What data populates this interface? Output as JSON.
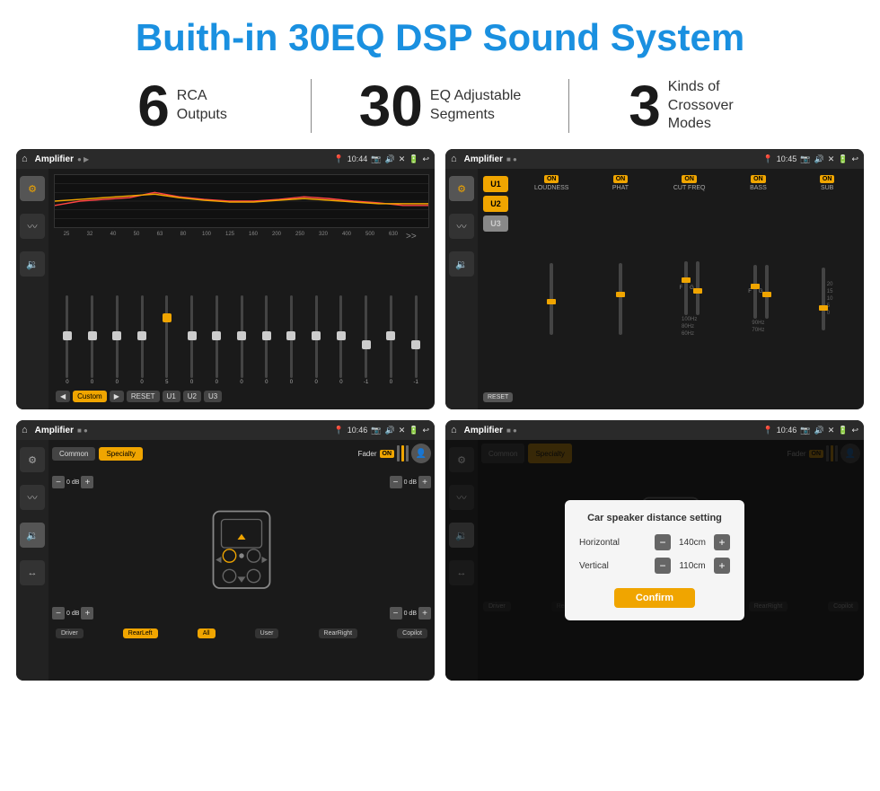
{
  "page": {
    "title": "Buith-in 30EQ DSP Sound System"
  },
  "stats": [
    {
      "number": "6",
      "label": "RCA\nOutputs"
    },
    {
      "number": "30",
      "label": "EQ Adjustable\nSegments"
    },
    {
      "number": "3",
      "label": "Kinds of\nCrossover Modes"
    }
  ],
  "screens": [
    {
      "id": "screen1",
      "statusBar": {
        "appTitle": "Amplifier",
        "time": "10:44"
      }
    },
    {
      "id": "screen2",
      "statusBar": {
        "appTitle": "Amplifier",
        "time": "10:45"
      }
    },
    {
      "id": "screen3",
      "statusBar": {
        "appTitle": "Amplifier",
        "time": "10:46"
      }
    },
    {
      "id": "screen4",
      "statusBar": {
        "appTitle": "Amplifier",
        "time": "10:46"
      },
      "dialog": {
        "title": "Car speaker distance setting",
        "fields": [
          {
            "label": "Horizontal",
            "value": "140cm"
          },
          {
            "label": "Vertical",
            "value": "110cm"
          }
        ],
        "confirmLabel": "Confirm"
      }
    }
  ],
  "eq": {
    "freqLabels": [
      "25",
      "32",
      "40",
      "50",
      "63",
      "80",
      "100",
      "125",
      "160",
      "200",
      "250",
      "320",
      "400",
      "500",
      "630"
    ],
    "values": [
      "0",
      "0",
      "0",
      "0",
      "5",
      "0",
      "0",
      "0",
      "0",
      "0",
      "0",
      "0",
      "-1",
      "0",
      "-1"
    ],
    "presetButtons": [
      "Custom",
      "RESET",
      "U1",
      "U2",
      "U3"
    ]
  },
  "crossover": {
    "channels": [
      "LOUDNESS",
      "PHAT",
      "CUT FREQ",
      "BASS",
      "SUB"
    ],
    "uButtons": [
      "U1",
      "U2",
      "U3"
    ],
    "resetLabel": "RESET"
  },
  "speaker": {
    "tabs": [
      "Common",
      "Specialty"
    ],
    "faderLabel": "Fader",
    "faderOnLabel": "ON",
    "bottomButtons": [
      "Driver",
      "RearLeft",
      "All",
      "User",
      "RearRight",
      "Copilot"
    ],
    "volLabels": [
      "0 dB",
      "0 dB",
      "0 dB",
      "0 dB"
    ]
  },
  "dialog": {
    "title": "Car speaker distance setting",
    "horizontalLabel": "Horizontal",
    "horizontalValue": "140cm",
    "verticalLabel": "Vertical",
    "verticalValue": "110cm",
    "confirmLabel": "Confirm"
  }
}
